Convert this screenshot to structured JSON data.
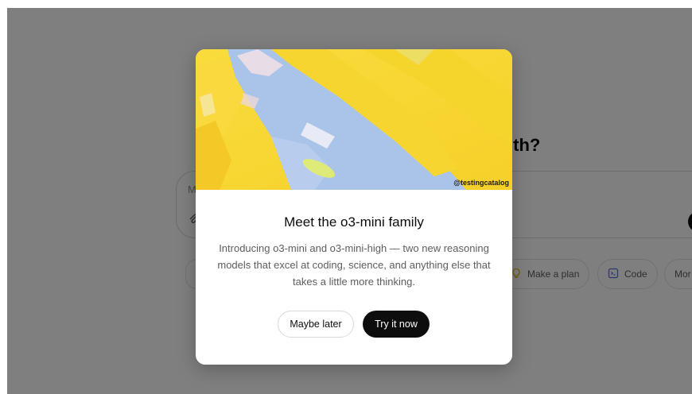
{
  "background": {
    "heading_fragment": "ith?",
    "composer_placeholder_fragment": "M",
    "chips": [
      {
        "label": "Make a plan",
        "icon": "lightbulb-icon"
      },
      {
        "label": "Code",
        "icon": "code-icon"
      },
      {
        "label": "Mor",
        "icon": ""
      }
    ]
  },
  "modal": {
    "watermark": "@testingcatalog",
    "title": "Meet the o3-mini family",
    "description": "Introducing o3-mini and o3-mini-high — two new reasoning models that excel at coding, science, and anything else that takes a little more thinking.",
    "secondary_button": "Maybe later",
    "primary_button": "Try it now"
  },
  "colors": {
    "overlay": "rgba(0,0,0,0.5)",
    "hero_yellow": "#f7d531",
    "hero_blue": "#a9c4e8",
    "primary_button_bg": "#0d0d0d"
  }
}
